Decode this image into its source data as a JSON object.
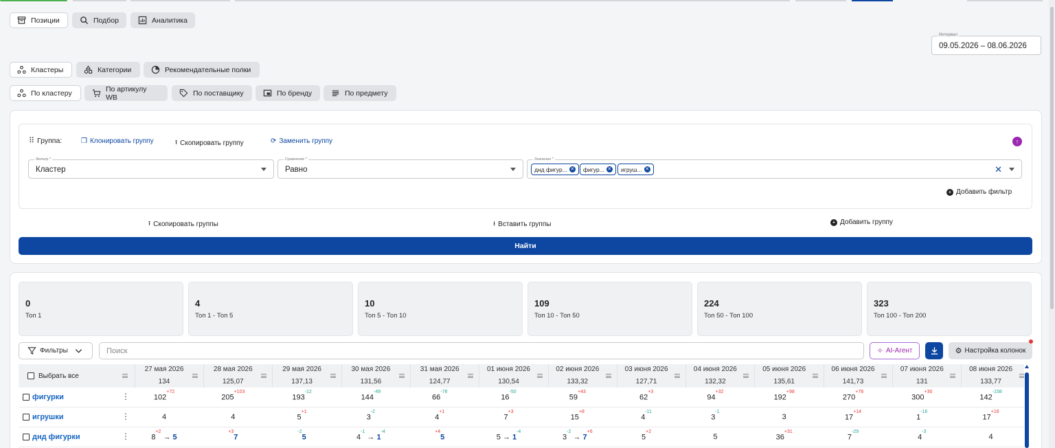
{
  "top_tabs": [
    {
      "label": "Позиции",
      "icon": "archive-icon",
      "active": true
    },
    {
      "label": "Подбор",
      "icon": "search-icon",
      "active": false
    },
    {
      "label": "Аналитика",
      "icon": "chart-icon",
      "active": false
    }
  ],
  "interval": {
    "label": "Интервал",
    "value": "09.05.2026 – 08.06.2026"
  },
  "mode_tabs": [
    {
      "label": "Кластеры",
      "icon": "cluster-icon",
      "active": true
    },
    {
      "label": "Категории",
      "icon": "shapes-icon",
      "active": false
    },
    {
      "label": "Рекомендательные полки",
      "icon": "pie-icon",
      "active": false
    }
  ],
  "sub_tabs": [
    {
      "label": "По кластеру",
      "icon": "cluster-icon",
      "active": true
    },
    {
      "label": "По артикулу WB",
      "icon": "cart-icon",
      "active": false
    },
    {
      "label": "По поставщику",
      "icon": "tag-icon",
      "active": false
    },
    {
      "label": "По бренду",
      "icon": "brand-icon",
      "active": false
    },
    {
      "label": "По предмету",
      "icon": "list-icon",
      "active": false
    }
  ],
  "group": {
    "label": "Группа:",
    "clone": "Клонировать группу",
    "copy": "Скопировать группу",
    "replace": "Заменить группу",
    "filter_label": "Фильтр *",
    "filter_value": "Кластер",
    "compare_label": "Сравнение *",
    "compare_value": "Равно",
    "value_label": "Значение *",
    "chips": [
      "днд фигур...",
      "фигур...",
      "игруш..."
    ],
    "add_filter": "Добавить фильтр"
  },
  "actions": {
    "copy_groups": "Скопировать группы",
    "paste_groups": "Вставить группы",
    "add_group": "Добавить группу",
    "find": "Найти"
  },
  "stats": [
    {
      "n": "0",
      "t": "Топ 1"
    },
    {
      "n": "4",
      "t": "Топ 1 - Топ 5"
    },
    {
      "n": "10",
      "t": "Топ 5 - Топ 10"
    },
    {
      "n": "109",
      "t": "Топ 10 - Топ 50"
    },
    {
      "n": "224",
      "t": "Топ 50 - Топ 100"
    },
    {
      "n": "323",
      "t": "Топ 100 - Топ 200"
    }
  ],
  "toolbar": {
    "filters": "Фильтры",
    "search_placeholder": "Поиск",
    "ai": "AI-Агент",
    "columns": "Настройка колонок"
  },
  "table": {
    "select_all": "Выбрать все",
    "columns": [
      {
        "date": "27 мая 2026",
        "value": "134"
      },
      {
        "date": "28 мая 2026",
        "value": "125,07"
      },
      {
        "date": "29 мая 2026",
        "value": "137,13"
      },
      {
        "date": "30 мая 2026",
        "value": "131,56"
      },
      {
        "date": "31 мая 2026",
        "value": "124,77"
      },
      {
        "date": "01 июня 2026",
        "value": "130,54"
      },
      {
        "date": "02 июня 2026",
        "value": "133,32"
      },
      {
        "date": "03 июня 2026",
        "value": "127,71"
      },
      {
        "date": "04 июня 2026",
        "value": "132,32"
      },
      {
        "date": "05 июня 2026",
        "value": "135,61"
      },
      {
        "date": "06 июня 2026",
        "value": "141,73"
      },
      {
        "date": "07 июня 2026",
        "value": "131"
      },
      {
        "date": "08 июня 2026",
        "value": "133,77"
      }
    ],
    "rows": [
      {
        "name": "фигурки",
        "cells": [
          {
            "v": "102",
            "d": "+72",
            "dir": "up"
          },
          {
            "v": "205",
            "d": "+103",
            "dir": "up"
          },
          {
            "v": "193",
            "d": "-12",
            "dir": "dn"
          },
          {
            "v": "144",
            "d": "-49",
            "dir": "dn"
          },
          {
            "v": "66",
            "d": "-78",
            "dir": "dn"
          },
          {
            "v": "16",
            "d": "-50",
            "dir": "dn"
          },
          {
            "v": "59",
            "d": "+43",
            "dir": "up"
          },
          {
            "v": "62",
            "d": "+3",
            "dir": "up"
          },
          {
            "v": "94",
            "d": "+32",
            "dir": "up"
          },
          {
            "v": "192",
            "d": "+98",
            "dir": "up"
          },
          {
            "v": "270",
            "d": "+78",
            "dir": "up"
          },
          {
            "v": "300",
            "d": "+30",
            "dir": "up"
          },
          {
            "v": "142",
            "d": "-158",
            "dir": "dn"
          }
        ]
      },
      {
        "name": "игрушки",
        "cells": [
          {
            "v": "4",
            "d": "",
            "dir": ""
          },
          {
            "v": "4",
            "d": "",
            "dir": ""
          },
          {
            "v": "5",
            "d": "+1",
            "dir": "up"
          },
          {
            "v": "3",
            "d": "-2",
            "dir": "dn"
          },
          {
            "v": "4",
            "d": "+1",
            "dir": "up"
          },
          {
            "v": "7",
            "d": "+3",
            "dir": "up"
          },
          {
            "v": "15",
            "d": "+8",
            "dir": "up"
          },
          {
            "v": "4",
            "d": "-11",
            "dir": "dn"
          },
          {
            "v": "3",
            "d": "-1",
            "dir": "dn"
          },
          {
            "v": "3",
            "d": "",
            "dir": ""
          },
          {
            "v": "17",
            "d": "+14",
            "dir": "up"
          },
          {
            "v": "1",
            "d": "-16",
            "dir": "dn"
          },
          {
            "v": "17",
            "d": "+16",
            "dir": "up"
          }
        ]
      },
      {
        "name": "днд фигурки",
        "cells": [
          {
            "v": "8",
            "d": "+2",
            "dir": "up",
            "to": "5"
          },
          {
            "v": "",
            "d": "+3",
            "dir": "up",
            "to": "7"
          },
          {
            "v": "",
            "d": "-2",
            "dir": "dn",
            "to": "5"
          },
          {
            "v": "4",
            "d": "-1",
            "dir": "dn",
            "to": "1",
            "d2": "-4"
          },
          {
            "v": "",
            "d": "+4",
            "dir": "up",
            "to": "5"
          },
          {
            "v": "5",
            "d": "",
            "dir": "",
            "to": "1",
            "d2": "-4"
          },
          {
            "v": "3",
            "d": "-2",
            "dir": "dn",
            "to": "7",
            "d2": "+6"
          },
          {
            "v": "5",
            "d": "+2",
            "dir": "up"
          },
          {
            "v": "5",
            "d": "",
            "dir": ""
          },
          {
            "v": "36",
            "d": "+31",
            "dir": "up"
          },
          {
            "v": "7",
            "d": "-29",
            "dir": "dn"
          },
          {
            "v": "4",
            "d": "-3",
            "dir": "dn"
          },
          {
            "v": "4",
            "d": "",
            "dir": ""
          }
        ]
      }
    ]
  }
}
